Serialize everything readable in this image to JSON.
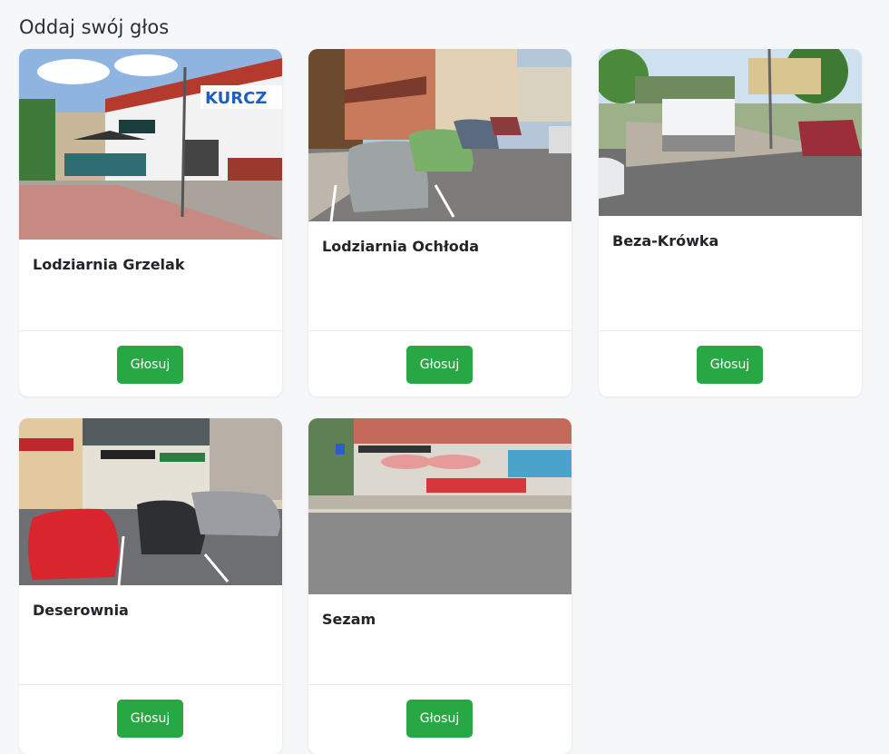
{
  "page": {
    "title": "Oddaj swój głos"
  },
  "cards": [
    {
      "name": "Lodziarnia Grzelak",
      "vote_label": "Głosuj"
    },
    {
      "name": "Lodziarnia Ochłoda",
      "vote_label": "Głosuj"
    },
    {
      "name": "Beza-Krówka",
      "vote_label": "Głosuj"
    },
    {
      "name": "Deserownia",
      "vote_label": "Głosuj"
    },
    {
      "name": "Sezam",
      "vote_label": "Głosuj"
    }
  ],
  "colors": {
    "vote_button": "#28a745",
    "page_background": "#f6f7f9",
    "card_background": "#ffffff"
  }
}
